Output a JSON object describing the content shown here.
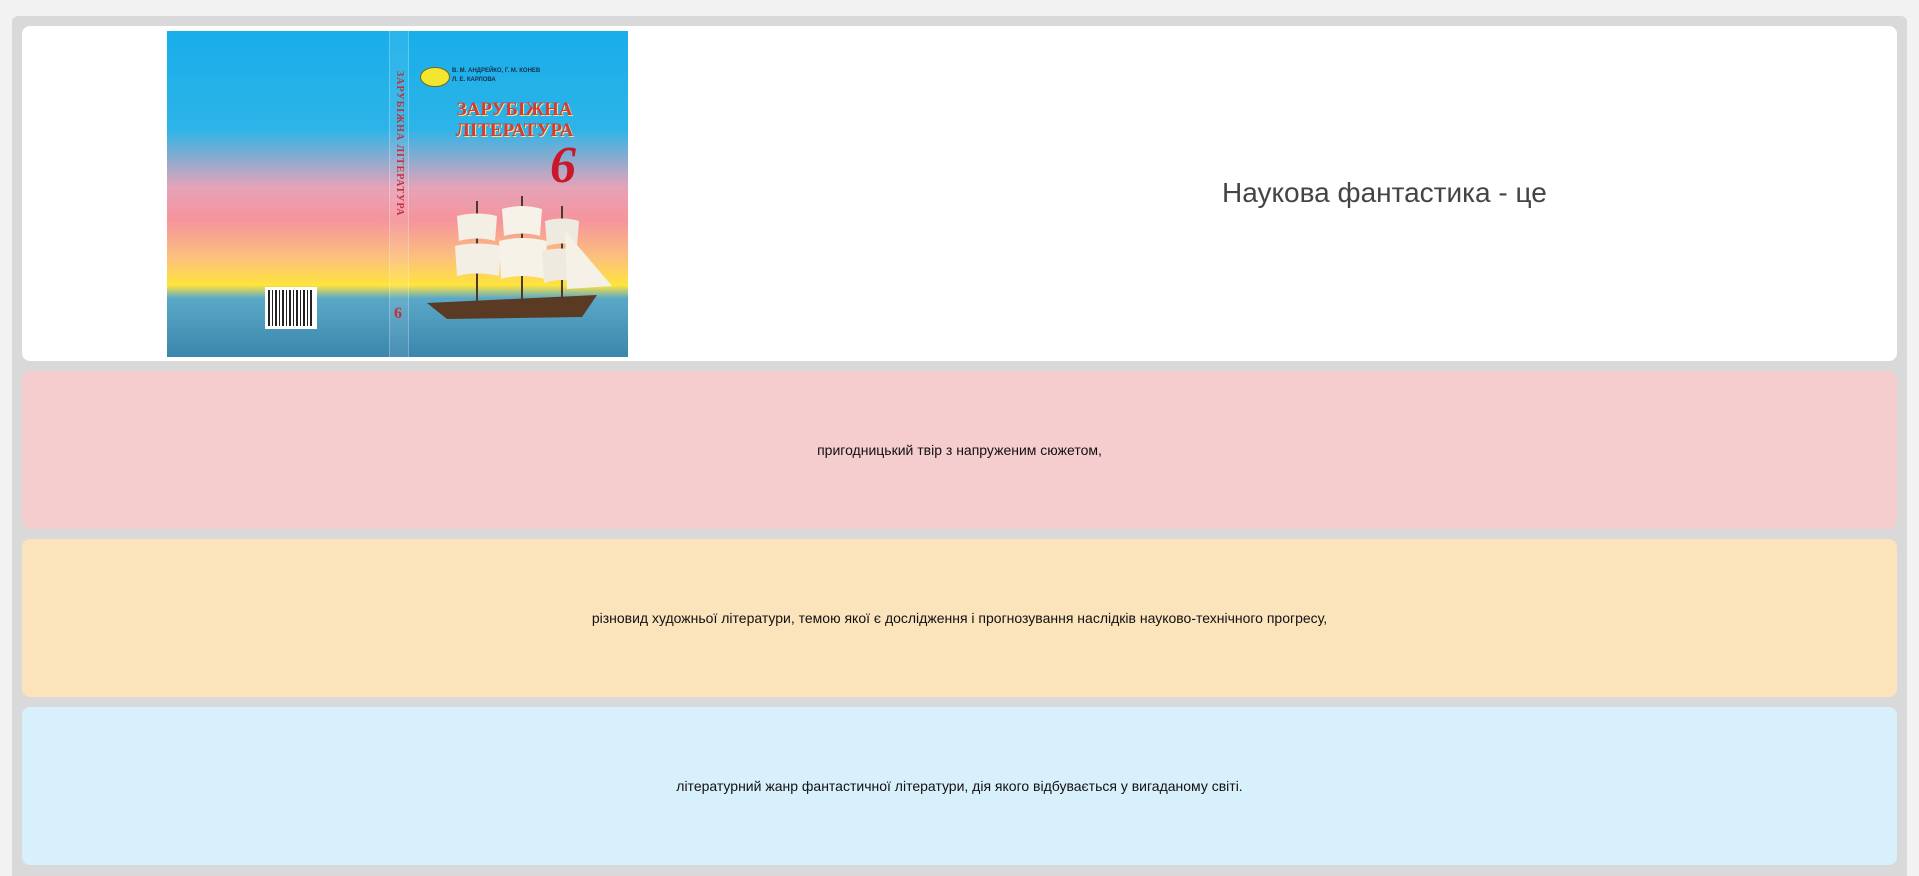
{
  "quiz": {
    "question": "Наукова фантастика - це",
    "cover": {
      "authors_line1": "В. М. АНДРЕЙКО, Г. М. КОНЕВ",
      "authors_line2": "Л. Е. КАРЛОВА",
      "title_line1": "ЗАРУБІЖНА",
      "title_line2": "ЛІТЕРАТУРА",
      "grade": "6",
      "spine_title": "ЗАРУБІЖНА ЛІТЕРАТУРА",
      "spine_grade": "6"
    },
    "answers": [
      {
        "label": "пригодницький твір з напруженим сюжетом,",
        "color": "#f6cdce"
      },
      {
        "label": "різновид художньої літератури, темою якої є дослідження і прогнозування наслідків науково-технічного прогресу,",
        "color": "#fbe3bc"
      },
      {
        "label": "літературний жанр фантастичної літератури, дія якого відбувається у вигаданому світі.",
        "color": "#d8f0fb"
      }
    ]
  }
}
